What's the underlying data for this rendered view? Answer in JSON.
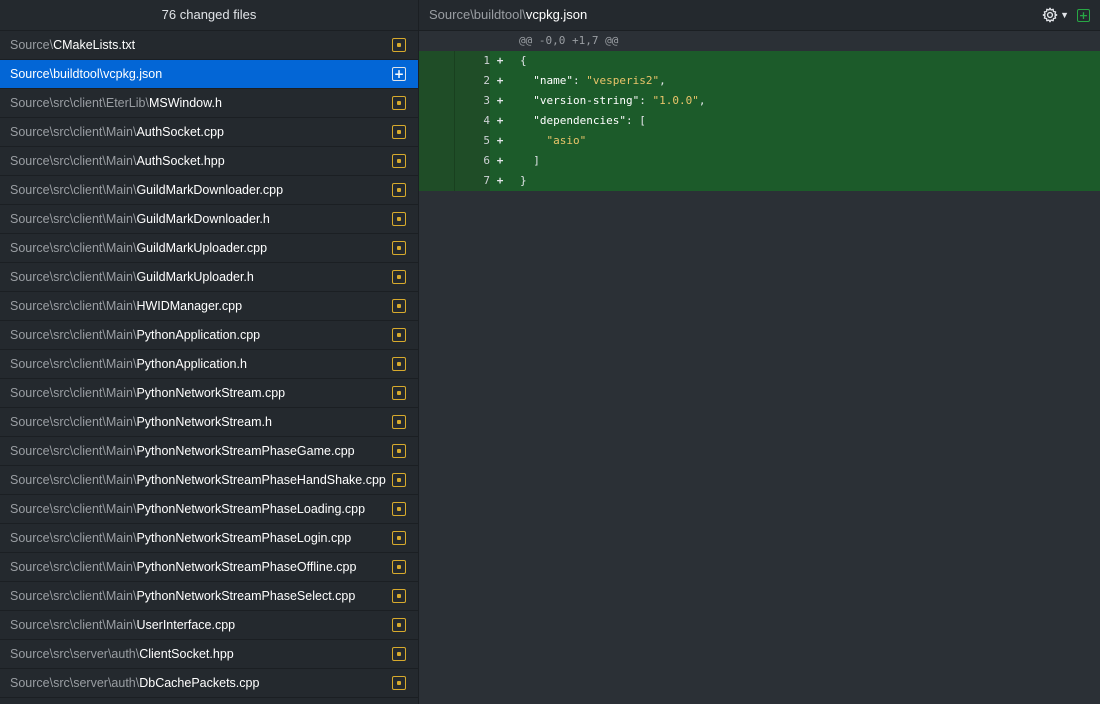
{
  "sidebar": {
    "header": "76 changed files",
    "files": [
      {
        "dir": "Source\\",
        "name": "CMakeLists.txt",
        "status": "modified"
      },
      {
        "dir": "Source\\buildtool\\",
        "name": "vcpkg.json",
        "status": "added",
        "selected": true
      },
      {
        "dir": "Source\\src\\client\\EterLib\\",
        "name": "MSWindow.h",
        "status": "modified"
      },
      {
        "dir": "Source\\src\\client\\Main\\",
        "name": "AuthSocket.cpp",
        "status": "modified"
      },
      {
        "dir": "Source\\src\\client\\Main\\",
        "name": "AuthSocket.hpp",
        "status": "modified"
      },
      {
        "dir": "Source\\src\\client\\Main\\",
        "name": "GuildMarkDownloader.cpp",
        "status": "modified"
      },
      {
        "dir": "Source\\src\\client\\Main\\",
        "name": "GuildMarkDownloader.h",
        "status": "modified"
      },
      {
        "dir": "Source\\src\\client\\Main\\",
        "name": "GuildMarkUploader.cpp",
        "status": "modified"
      },
      {
        "dir": "Source\\src\\client\\Main\\",
        "name": "GuildMarkUploader.h",
        "status": "modified"
      },
      {
        "dir": "Source\\src\\client\\Main\\",
        "name": "HWIDManager.cpp",
        "status": "modified"
      },
      {
        "dir": "Source\\src\\client\\Main\\",
        "name": "PythonApplication.cpp",
        "status": "modified"
      },
      {
        "dir": "Source\\src\\client\\Main\\",
        "name": "PythonApplication.h",
        "status": "modified"
      },
      {
        "dir": "Source\\src\\client\\Main\\",
        "name": "PythonNetworkStream.cpp",
        "status": "modified"
      },
      {
        "dir": "Source\\src\\client\\Main\\",
        "name": "PythonNetworkStream.h",
        "status": "modified"
      },
      {
        "dir": "Source\\src\\client\\Main\\",
        "name": "PythonNetworkStreamPhaseGame.cpp",
        "status": "modified"
      },
      {
        "dir": "Source\\src\\client\\Main\\",
        "name": "PythonNetworkStreamPhaseHandShake.cpp",
        "status": "modified"
      },
      {
        "dir": "Source\\src\\client\\Main\\",
        "name": "PythonNetworkStreamPhaseLoading.cpp",
        "status": "modified"
      },
      {
        "dir": "Source\\src\\client\\Main\\",
        "name": "PythonNetworkStreamPhaseLogin.cpp",
        "status": "modified"
      },
      {
        "dir": "Source\\src\\client\\Main\\",
        "name": "PythonNetworkStreamPhaseOffline.cpp",
        "status": "modified"
      },
      {
        "dir": "Source\\src\\client\\Main\\",
        "name": "PythonNetworkStreamPhaseSelect.cpp",
        "status": "modified"
      },
      {
        "dir": "Source\\src\\client\\Main\\",
        "name": "UserInterface.cpp",
        "status": "modified"
      },
      {
        "dir": "Source\\src\\server\\auth\\",
        "name": "ClientSocket.hpp",
        "status": "modified"
      },
      {
        "dir": "Source\\src\\server\\auth\\",
        "name": "DbCachePackets.cpp",
        "status": "modified"
      }
    ]
  },
  "diff": {
    "file_dir": "Source\\buildtool\\",
    "file_name": "vcpkg.json",
    "settings_icon": "gear-icon",
    "expand_icon": "plus-square-icon",
    "hunk_header": "@@ -0,0 +1,7 @@",
    "lines": [
      {
        "num": "1",
        "marker": "+",
        "indent": "",
        "parts": [
          {
            "t": "{",
            "c": "plain"
          }
        ]
      },
      {
        "num": "2",
        "marker": "+",
        "indent": "  ",
        "parts": [
          {
            "t": "\"name\"",
            "c": "key"
          },
          {
            "t": ": ",
            "c": "plain"
          },
          {
            "t": "\"vesperis2\"",
            "c": "str"
          },
          {
            "t": ",",
            "c": "plain"
          }
        ]
      },
      {
        "num": "3",
        "marker": "+",
        "indent": "  ",
        "parts": [
          {
            "t": "\"version-string\"",
            "c": "key"
          },
          {
            "t": ": ",
            "c": "plain"
          },
          {
            "t": "\"1.0.0\"",
            "c": "str"
          },
          {
            "t": ",",
            "c": "plain"
          }
        ]
      },
      {
        "num": "4",
        "marker": "+",
        "indent": "  ",
        "parts": [
          {
            "t": "\"dependencies\"",
            "c": "key"
          },
          {
            "t": ": [",
            "c": "plain"
          }
        ]
      },
      {
        "num": "5",
        "marker": "+",
        "indent": "    ",
        "parts": [
          {
            "t": "\"asio\"",
            "c": "str"
          }
        ]
      },
      {
        "num": "6",
        "marker": "+",
        "indent": "  ",
        "parts": [
          {
            "t": "]",
            "c": "plain"
          }
        ]
      },
      {
        "num": "7",
        "marker": "+",
        "indent": "",
        "parts": [
          {
            "t": "}",
            "c": "plain"
          }
        ]
      }
    ]
  },
  "colors": {
    "selected_row": "#0366d6",
    "modified_icon": "#d7aa2d",
    "added_line_bg": "#1c5b2a",
    "expand_icon": "#28a745"
  }
}
